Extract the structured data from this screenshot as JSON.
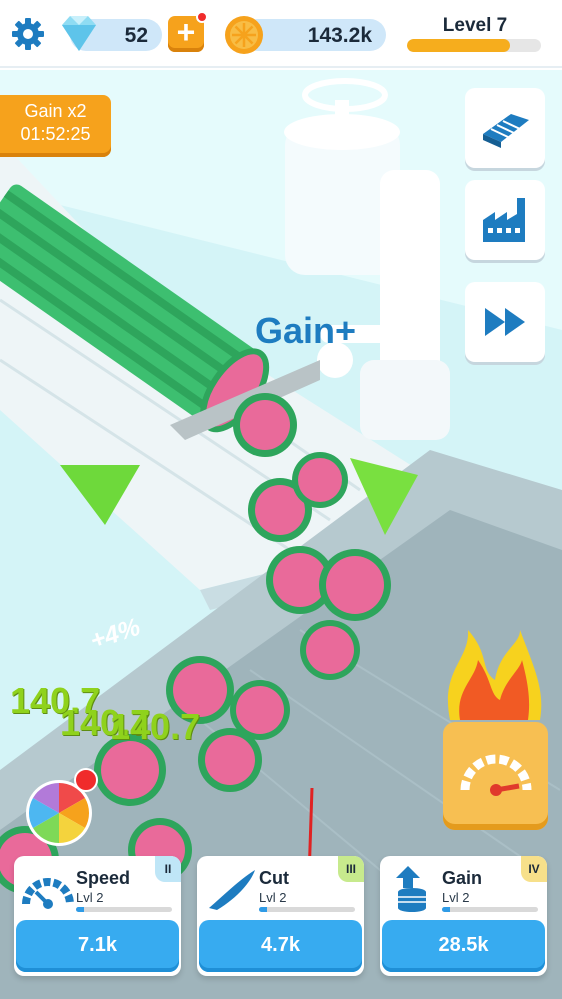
{
  "hud": {
    "gems": "52",
    "coins": "143.2k",
    "level_label": "Level 7",
    "level_progress": 0.77
  },
  "gain_boost": {
    "label": "Gain x2",
    "timer": "01:52:25"
  },
  "side_buttons": [
    {
      "icon": "conveyor-icon"
    },
    {
      "icon": "factory-icon"
    },
    {
      "icon": "fast-forward-icon"
    }
  ],
  "scene_text": {
    "gain_plus": "Gain+",
    "percent": "+4%",
    "floating_values": [
      "140.7",
      "140.7",
      "140.7"
    ]
  },
  "cards": [
    {
      "title": "Speed",
      "level": "Lvl 2",
      "tier": "II",
      "price": "7.1k",
      "progress": 0.08,
      "icon": "speedometer-icon",
      "tier_color": "#bfe6f7"
    },
    {
      "title": "Cut",
      "level": "Lvl 2",
      "tier": "III",
      "price": "4.7k",
      "progress": 0.08,
      "icon": "knife-icon",
      "tier_color": "#c7ea8d"
    },
    {
      "title": "Gain",
      "level": "Lvl 2",
      "tier": "IV",
      "price": "28.5k",
      "progress": 0.08,
      "icon": "coins-stack-icon",
      "tier_color": "#f7e08a"
    }
  ],
  "colors": {
    "accent_orange": "#f6a21c",
    "button_blue": "#37abf0",
    "watermelon_green": "#3dbf70",
    "watermelon_pink": "#e96a9a"
  }
}
